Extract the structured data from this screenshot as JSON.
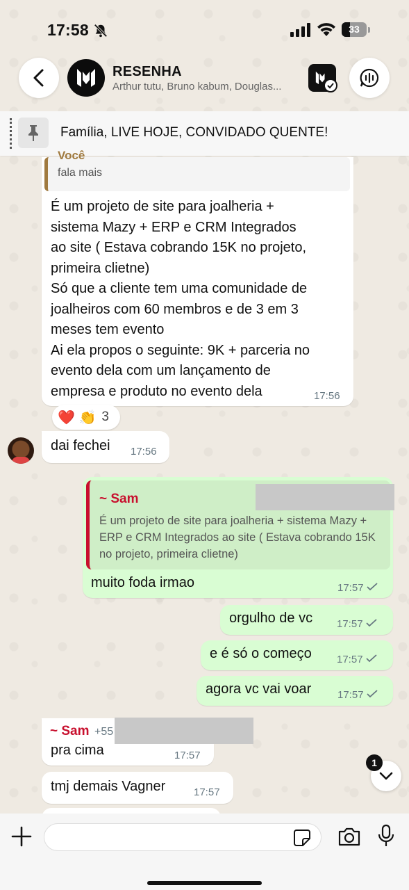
{
  "status_bar": {
    "time": "17:58",
    "battery": "33"
  },
  "header": {
    "group_name": "RESENHA",
    "members": "Arthur tutu, Bruno kabum, Douglas..."
  },
  "pinned": {
    "text": "Família, LIVE HOJE, CONVIDADO QUENTE!"
  },
  "messages": [
    {
      "quote_author": "Você",
      "quote_text": "fala mais",
      "lines": [
        "É um projeto de site para joalheria +",
        "sistema Mazy + ERP e CRM Integrados",
        "ao site ( Estava cobrando 15K no projeto,",
        "primeira clietne)",
        "Só que a cliente tem uma comunidade de",
        "joalheiros com 60 membros e de 3 em 3",
        "meses tem evento",
        "Ai ela propos o seguinte: 9K + parceria no",
        "evento dela com um lançamento de",
        "empresa e produto no evento dela"
      ],
      "time": "17:56",
      "reactions": {
        "emojis": "❤️ 👏",
        "count": "3"
      }
    },
    {
      "text": "dai fechei",
      "time": "17:56"
    },
    {
      "quote_author": "~ Sam",
      "quote_text": "É um projeto de site para joalheria + sistema Mazy + ERP e CRM Integrados ao site ( Estava cobrando 15K no projeto, primeira clietne)",
      "text": "muito foda irmao",
      "time": "17:57"
    },
    {
      "text": "orgulho de vc",
      "time": "17:57"
    },
    {
      "text": "e é só o começo",
      "time": "17:57"
    },
    {
      "text": "agora vc vai voar",
      "time": "17:57"
    },
    {
      "author": "~ Sam",
      "phone_prefix": "+55",
      "text": "pra cima",
      "time": "17:57"
    },
    {
      "text": "tmj demais Vagner",
      "time": "17:57"
    }
  ],
  "scroll_badge": "1",
  "composer": {
    "placeholder": ""
  },
  "icons": {
    "back": "chevron-left-icon",
    "voice_chat": "voice-chat-icon",
    "pin": "pin-icon",
    "plus": "plus-icon",
    "sticker": "sticker-icon",
    "camera": "camera-icon",
    "mic": "mic-icon"
  }
}
